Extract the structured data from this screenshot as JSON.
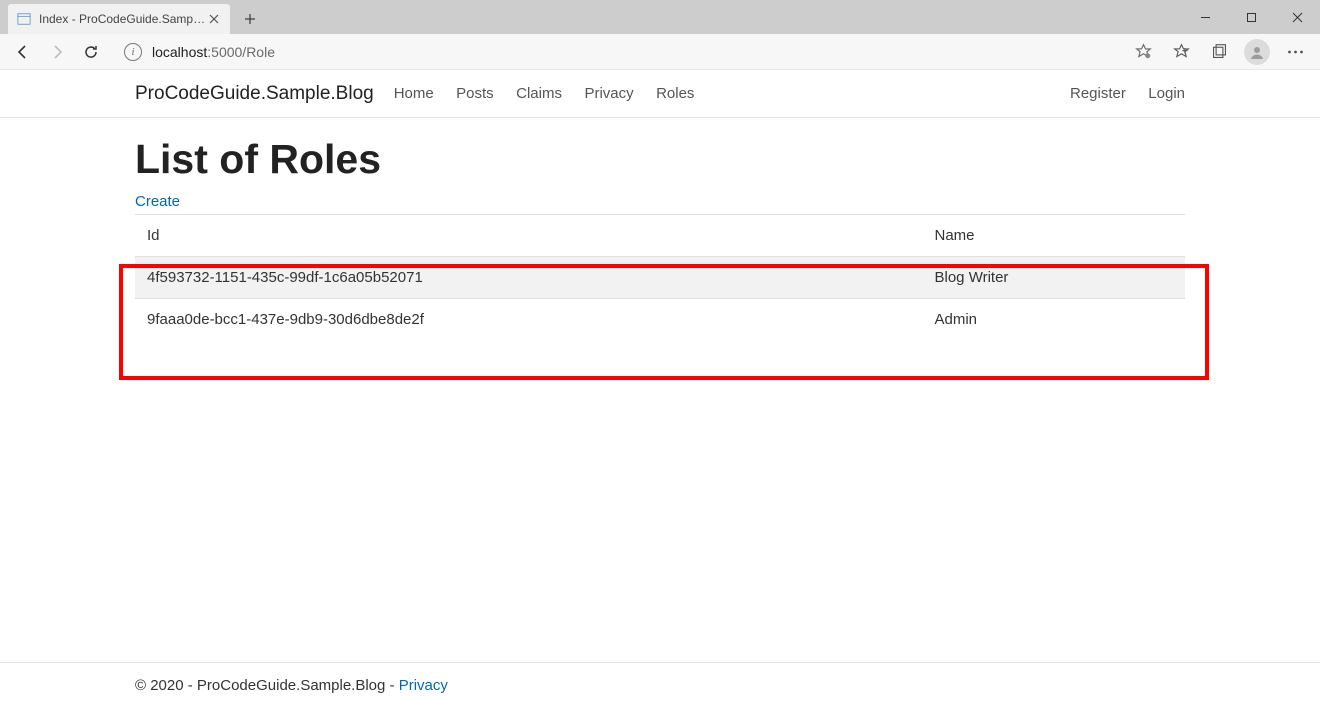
{
  "browser": {
    "tab_title": "Index - ProCodeGuide.Sample.Bl",
    "url_host": "localhost",
    "url_port_path": ":5000/Role"
  },
  "nav": {
    "brand": "ProCodeGuide.Sample.Blog",
    "links": [
      "Home",
      "Posts",
      "Claims",
      "Privacy",
      "Roles"
    ],
    "right": [
      "Register",
      "Login"
    ]
  },
  "page": {
    "heading": "List of Roles",
    "create_label": "Create"
  },
  "table": {
    "columns": [
      "Id",
      "Name"
    ],
    "rows": [
      {
        "id": "4f593732-1151-435c-99df-1c6a05b52071",
        "name": "Blog Writer"
      },
      {
        "id": "9faaa0de-bcc1-437e-9db9-30d6dbe8de2f",
        "name": "Admin"
      }
    ]
  },
  "footer": {
    "text": "© 2020 - ProCodeGuide.Sample.Blog - ",
    "privacy": "Privacy"
  }
}
